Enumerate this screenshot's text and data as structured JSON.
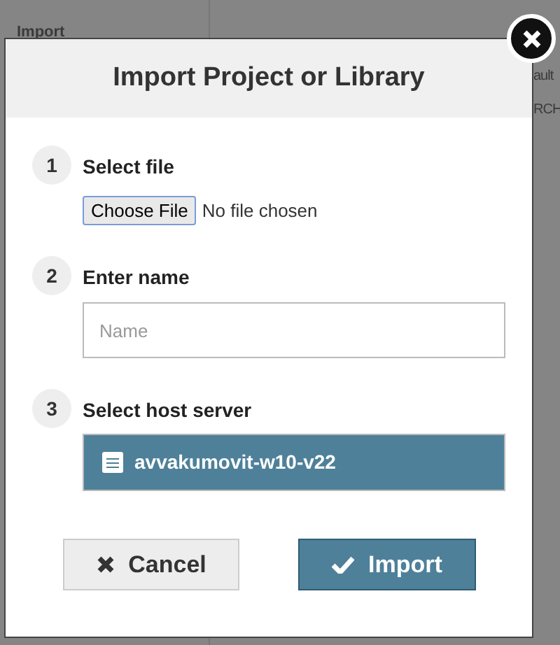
{
  "background": {
    "sidebar_heading": "Import",
    "column_texts": [
      "ault",
      "RCH"
    ]
  },
  "dialog": {
    "title": "Import Project or Library",
    "steps": [
      {
        "number": "1",
        "label": "Select file",
        "kind": "file",
        "button": "Choose File",
        "status": "No file chosen"
      },
      {
        "number": "2",
        "label": "Enter name",
        "kind": "text",
        "placeholder": "Name"
      },
      {
        "number": "3",
        "label": "Select host server",
        "kind": "list",
        "items": [
          {
            "name": "avvakumovit-w10-v22",
            "selected": true
          }
        ]
      }
    ],
    "buttons": [
      {
        "label": "Cancel",
        "kind": "cancel"
      },
      {
        "label": "Import",
        "kind": "primary"
      }
    ]
  }
}
